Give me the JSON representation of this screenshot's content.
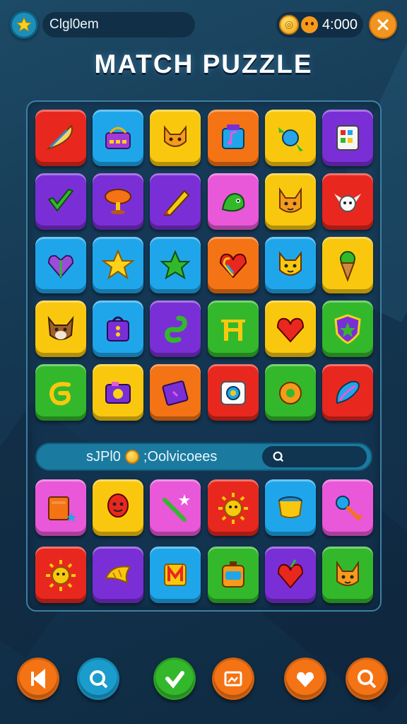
{
  "header": {
    "player_name": "Clgl0em",
    "coins": "4:000",
    "icons": {
      "level": "star-icon",
      "coin": "coin-icon",
      "face": "smiley-icon",
      "close": "close-icon"
    }
  },
  "title": "MATCH PUZZLE",
  "colors": {
    "red": "#e8281e",
    "blue": "#1fa6ea",
    "yellow": "#f9c80e",
    "orange": "#f47314",
    "purple": "#7a2fd6",
    "green": "#33b82c",
    "pink": "#e958d8",
    "accent": "#f2941e"
  },
  "board": {
    "rows_top": [
      [
        {
          "color": "red",
          "icon": "feather"
        },
        {
          "color": "blue",
          "icon": "basket"
        },
        {
          "color": "yellow",
          "icon": "fox"
        },
        {
          "color": "orange",
          "icon": "music-box"
        },
        {
          "color": "yellow",
          "icon": "candy"
        },
        {
          "color": "purple",
          "icon": "palette-box"
        }
      ],
      [
        {
          "color": "purple",
          "icon": "checkmark"
        },
        {
          "color": "purple",
          "icon": "mushroom-lamp"
        },
        {
          "color": "purple",
          "icon": "pencil"
        },
        {
          "color": "pink",
          "icon": "dragon"
        },
        {
          "color": "yellow",
          "icon": "fox-face"
        },
        {
          "color": "red",
          "icon": "cat-wings"
        }
      ],
      [
        {
          "color": "blue",
          "icon": "gem-heart"
        },
        {
          "color": "blue",
          "icon": "star"
        },
        {
          "color": "blue",
          "icon": "leaf-star"
        },
        {
          "color": "orange",
          "icon": "rainbow-heart"
        },
        {
          "color": "blue",
          "icon": "cat-face"
        },
        {
          "color": "yellow",
          "icon": "ice-cream"
        }
      ],
      [
        {
          "color": "yellow",
          "icon": "dog-face"
        },
        {
          "color": "blue",
          "icon": "purse"
        },
        {
          "color": "purple",
          "icon": "snake"
        },
        {
          "color": "green",
          "icon": "gate"
        },
        {
          "color": "yellow",
          "icon": "heart"
        },
        {
          "color": "green",
          "icon": "shield"
        }
      ],
      [
        {
          "color": "green",
          "icon": "swirl"
        },
        {
          "color": "yellow",
          "icon": "camera"
        },
        {
          "color": "orange",
          "icon": "diamond-card"
        },
        {
          "color": "red",
          "icon": "robot"
        },
        {
          "color": "green",
          "icon": "donut"
        },
        {
          "color": "red",
          "icon": "feather-blue"
        }
      ]
    ],
    "status_text": "sJPl0",
    "status_text2": ";Oolvicoees",
    "status_icon": "search-icon",
    "rows_bottom": [
      [
        {
          "color": "pink",
          "icon": "book"
        },
        {
          "color": "yellow",
          "icon": "balloon-face"
        },
        {
          "color": "pink",
          "icon": "wand"
        },
        {
          "color": "red",
          "icon": "sun-face"
        },
        {
          "color": "blue",
          "icon": "drum"
        },
        {
          "color": "pink",
          "icon": "key"
        }
      ],
      [
        {
          "color": "red",
          "icon": "sun-face"
        },
        {
          "color": "purple",
          "icon": "croissant"
        },
        {
          "color": "blue",
          "icon": "letter-m"
        },
        {
          "color": "green",
          "icon": "box-face"
        },
        {
          "color": "purple",
          "icon": "apple-heart"
        },
        {
          "color": "green",
          "icon": "fox-face"
        }
      ]
    ]
  },
  "bottom_nav": [
    {
      "icon": "back-icon",
      "color": "#f47314"
    },
    {
      "icon": "search-icon",
      "color": "#1a9ccc"
    },
    {
      "icon": "check-icon",
      "color": "#33b82c"
    },
    {
      "icon": "image-icon",
      "color": "#f47314"
    },
    {
      "icon": "heart-icon",
      "color": "#f47314"
    },
    {
      "icon": "magnify-icon",
      "color": "#f47314"
    }
  ]
}
